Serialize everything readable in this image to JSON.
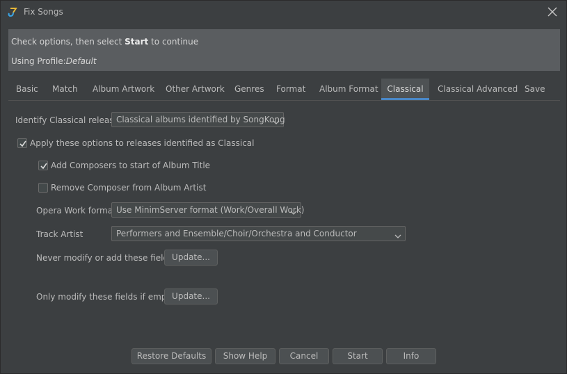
{
  "window": {
    "title": "Fix Songs",
    "icons": {
      "app": "songkong-icon",
      "close": "close-icon"
    }
  },
  "info": {
    "prefix": "Check options, then select ",
    "start_word": "Start",
    "suffix": " to continue",
    "profile_label": "Using Profile:",
    "profile_name": "Default"
  },
  "tabs": [
    {
      "label": "Basic"
    },
    {
      "label": "Match"
    },
    {
      "label": "Album Artwork"
    },
    {
      "label": "Other Artwork"
    },
    {
      "label": "Genres"
    },
    {
      "label": "Format"
    },
    {
      "label": "Album Format"
    },
    {
      "label": "Classical",
      "active": true
    },
    {
      "label": "Classical Advanced"
    },
    {
      "label": "Save"
    }
  ],
  "options": {
    "identify_label": "Identify Classical releases",
    "identify_value": "Classical albums identified by SongKong",
    "apply_label": "Apply these options to releases identified as Classical",
    "apply_checked": true,
    "add_composers_label": "Add Composers to start of Album Title",
    "add_composers_checked": true,
    "remove_composer_label": "Remove Composer from Album Artist",
    "remove_composer_checked": false,
    "opera_label": "Opera Work format",
    "opera_value": "Use MinimServer format (Work/Overall Work)",
    "track_artist_label": "Track Artist",
    "track_artist_value": "Performers and Ensemble/Choir/Orchestra and Conductor",
    "never_modify_label": "Never modify or add these fields:",
    "never_modify_button": "Update...",
    "only_modify_label": "Only modify these fields if empty:",
    "only_modify_button": "Update..."
  },
  "buttons": {
    "restore": "Restore Defaults",
    "help": "Show Help",
    "cancel": "Cancel",
    "start": "Start",
    "info": "Info"
  },
  "colors": {
    "background": "#3c3f41",
    "info_panel": "#5a5d60",
    "tab_accent": "#4a88c7"
  }
}
